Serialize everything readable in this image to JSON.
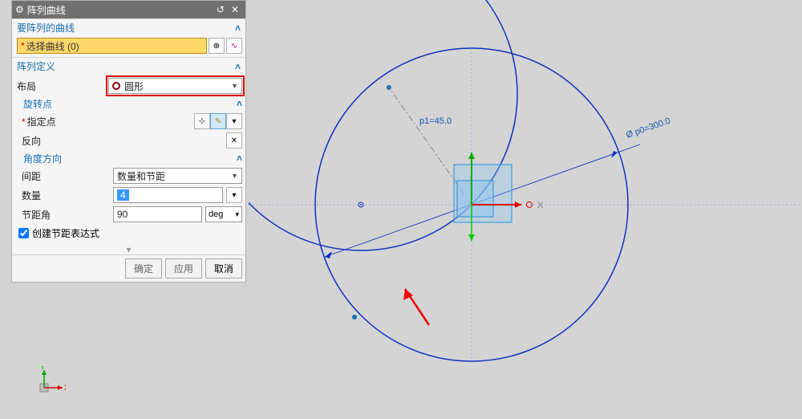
{
  "title": "阵列曲线",
  "sections": {
    "curves": {
      "title": "要阵列的曲线",
      "select_label": "选择曲线 (0)"
    },
    "definition": {
      "title": "阵列定义",
      "layout_label": "布局",
      "layout_value": "圆形",
      "rotation": {
        "title": "旋转点",
        "point_label": "指定点",
        "reverse_label": "反向"
      },
      "angle": {
        "title": "角度方向",
        "spacing_label": "间距",
        "spacing_value": "数量和节距",
        "count_label": "数量",
        "count_value": "4",
        "pitch_label": "节距角",
        "pitch_value": "90",
        "pitch_unit": "deg"
      },
      "create_expr": "创建节距表达式"
    }
  },
  "buttons": {
    "ok": "确定",
    "apply": "应用",
    "cancel": "取消"
  },
  "graphics": {
    "dim_angle": "p1=45.0",
    "dim_diameter": "Ø p0=300.0",
    "axis_x": "X",
    "axis_y": "Y"
  }
}
